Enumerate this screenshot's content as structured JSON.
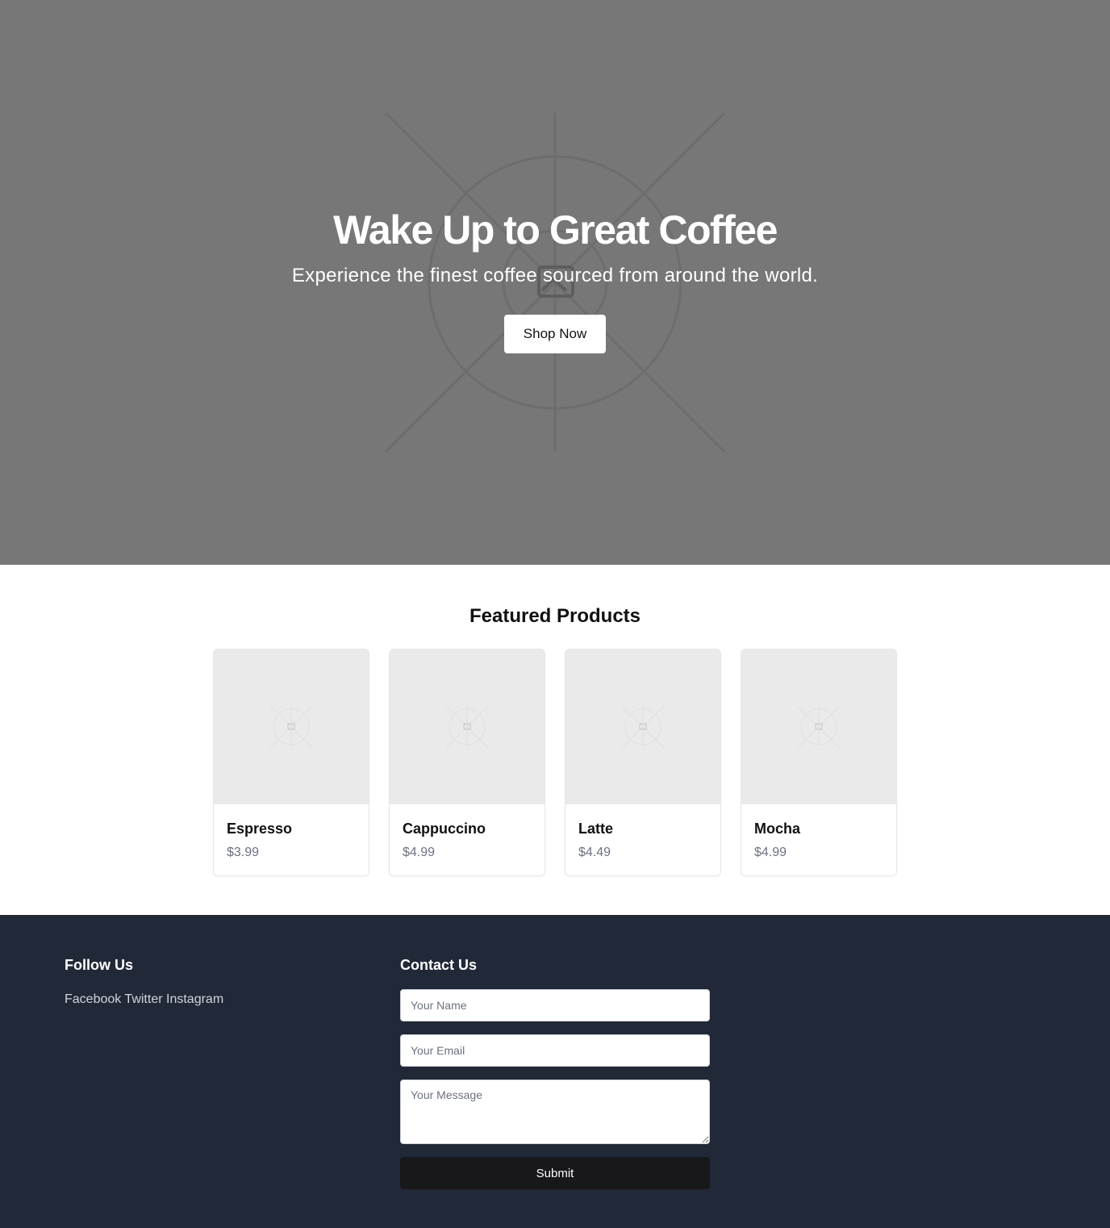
{
  "hero": {
    "title": "Wake Up to Great Coffee",
    "subtitle": "Experience the finest coffee sourced from around the world.",
    "cta_label": "Shop Now",
    "background_icon": "image-placeholder-icon",
    "background_color": "#777777"
  },
  "featured": {
    "title": "Featured Products",
    "products": [
      {
        "name": "Espresso",
        "price": "$3.99",
        "image_icon": "image-placeholder-icon"
      },
      {
        "name": "Cappuccino",
        "price": "$4.99",
        "image_icon": "image-placeholder-icon"
      },
      {
        "name": "Latte",
        "price": "$4.49",
        "image_icon": "image-placeholder-icon"
      },
      {
        "name": "Mocha",
        "price": "$4.99",
        "image_icon": "image-placeholder-icon"
      }
    ]
  },
  "footer": {
    "follow_title": "Follow Us",
    "social_links": [
      "Facebook",
      "Twitter",
      "Instagram"
    ],
    "contact_title": "Contact Us",
    "name_placeholder": "Your Name",
    "email_placeholder": "Your Email",
    "message_placeholder": "Your Message",
    "submit_label": "Submit",
    "background_color": "#212938"
  }
}
